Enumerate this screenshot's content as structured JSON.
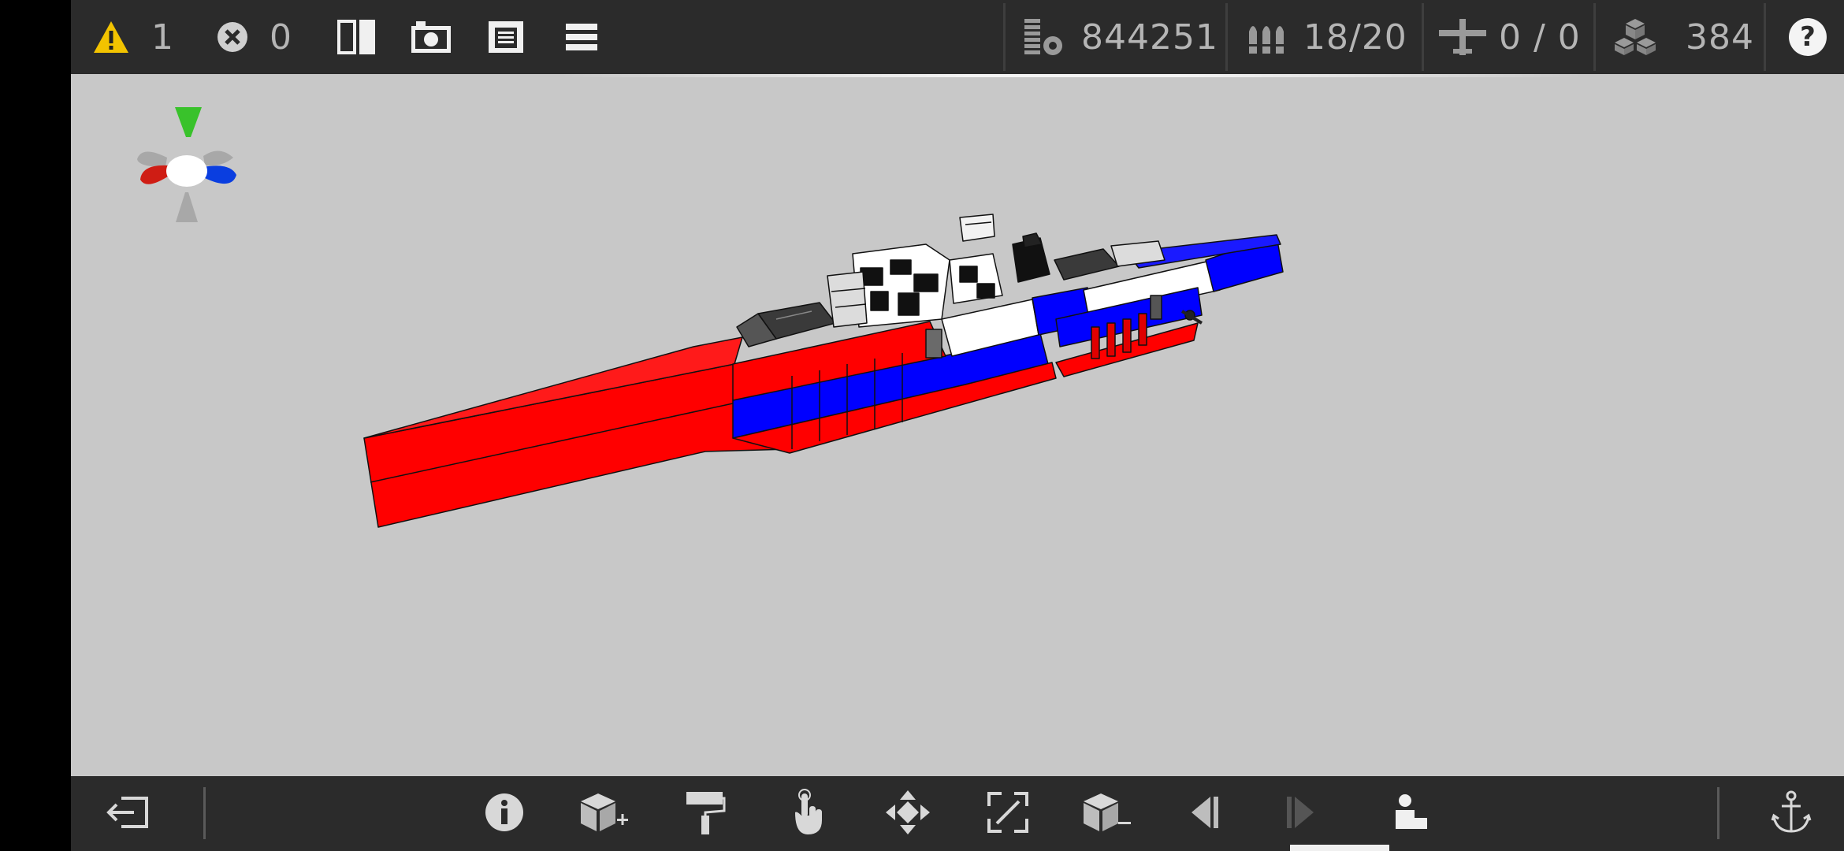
{
  "topbar": {
    "warnings": "1",
    "errors": "0",
    "cost": "844251",
    "ammo": "18/20",
    "aircraft": "0 / 0",
    "parts": "384",
    "help": "?"
  },
  "icons": {
    "warning": "warning-triangle-icon",
    "error": "error-x-icon",
    "mirror": "mirror-split-icon",
    "camera": "camera-icon",
    "save": "save-icon",
    "menu": "hamburger-menu-icon",
    "cost": "coin-stack-icon",
    "ammo": "ammo-shells-icon",
    "aircraft": "airplane-icon",
    "parts": "blocks-icon",
    "help": "help-icon",
    "exit": "exit-icon",
    "info": "info-icon",
    "add_block": "add-block-icon",
    "paint": "paint-roller-icon",
    "select": "hand-pointer-icon",
    "move": "move-arrows-icon",
    "resize": "resize-icon",
    "remove_block": "remove-block-icon",
    "prev": "previous-icon",
    "next": "next-icon",
    "crew": "crew-seat-icon",
    "anchor": "anchor-icon"
  },
  "colors": {
    "warning_yellow": "#f2c300",
    "axis_green": "#39c22b",
    "axis_red": "#cf1d14",
    "axis_blue": "#0a3ee0",
    "hull_red": "#ff0000",
    "hull_blue": "#0000ff",
    "viewport_bg": "#c8c8c8",
    "toolbar_bg": "#2b2b2b"
  }
}
